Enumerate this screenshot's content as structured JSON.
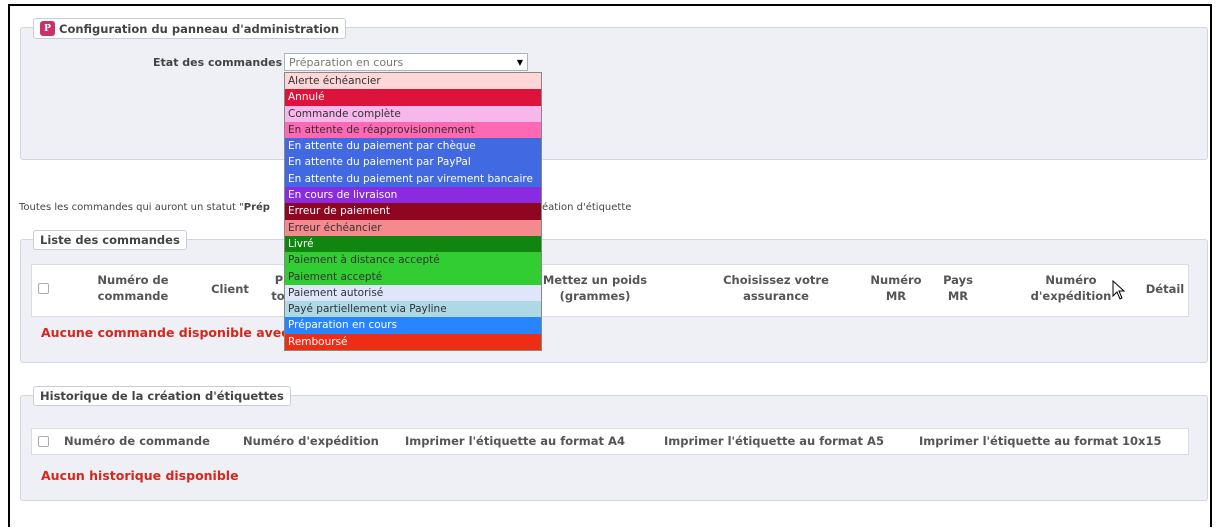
{
  "config": {
    "legend": "Configuration du panneau d'administration",
    "icon": "prestashop-icon",
    "etat_label": "Etat des commandes",
    "select_value": "Préparation en cours",
    "options": [
      {
        "label": "Alerte échéancier",
        "bg": "#fdd6d7",
        "fg": "#333333"
      },
      {
        "label": "Annulé",
        "bg": "#dc143c",
        "fg": "#ffffff"
      },
      {
        "label": "Commande complète",
        "bg": "#f7b7ea",
        "fg": "#333333"
      },
      {
        "label": "En attente de réapprovisionnement",
        "bg": "#ff69b4",
        "fg": "#333333"
      },
      {
        "label": "En attente du paiement par chèque",
        "bg": "#4169e1",
        "fg": "#ffffff"
      },
      {
        "label": "En attente du paiement par PayPal",
        "bg": "#4169e1",
        "fg": "#ffffff"
      },
      {
        "label": "En attente du paiement par virement bancaire",
        "bg": "#4169e1",
        "fg": "#ffffff"
      },
      {
        "label": "En cours de livraison",
        "bg": "#8a2be2",
        "fg": "#ffffff"
      },
      {
        "label": "Erreur de paiement",
        "bg": "#8f0621",
        "fg": "#ffffff"
      },
      {
        "label": "Erreur échéancier",
        "bg": "#f48a8d",
        "fg": "#333333"
      },
      {
        "label": "Livré",
        "bg": "#108510",
        "fg": "#ffffff"
      },
      {
        "label": "Paiement à distance accepté",
        "bg": "#32cd32",
        "fg": "#333333"
      },
      {
        "label": "Paiement accepté",
        "bg": "#32cd32",
        "fg": "#333333"
      },
      {
        "label": "Paiement autorisé",
        "bg": "#dfe5fb",
        "fg": "#333333"
      },
      {
        "label": "Payé partiellement via Payline",
        "bg": "#add8e6",
        "fg": "#333333"
      },
      {
        "label": "Préparation en cours",
        "bg": "#2685ff",
        "fg": "#ffffff"
      },
      {
        "label": "Remboursé",
        "bg": "#ec2e15",
        "fg": "#ffffff"
      }
    ]
  },
  "info": {
    "prefix": "Toutes les commandes qui auront un statut \"",
    "bold": "Prép",
    "suffix": "éation d'étiquette"
  },
  "orders": {
    "legend": "Liste des commandes",
    "columns": {
      "numero": "Numéro de commande",
      "client": "Client",
      "p_partial": "P",
      "to_partial": "to",
      "poids": "Mettez un poids (grammes)",
      "assurance": "Choisissez votre assurance",
      "numero_mr": "Numéro MR",
      "pays_mr": "Pays MR",
      "expedition": "Numéro d'expédition",
      "detail": "Détail"
    },
    "empty": "Aucune commande disponible avec"
  },
  "history": {
    "legend": "Historique de la création d'étiquettes",
    "columns": {
      "numero": "Numéro de commande",
      "expedition": "Numéro d'expédition",
      "a4": "Imprimer l'étiquette au format A4",
      "a5": "Imprimer l'étiquette au format A5",
      "f10x15": "Imprimer l'étiquette au format 10x15"
    },
    "empty": "Aucun historique disponible"
  }
}
